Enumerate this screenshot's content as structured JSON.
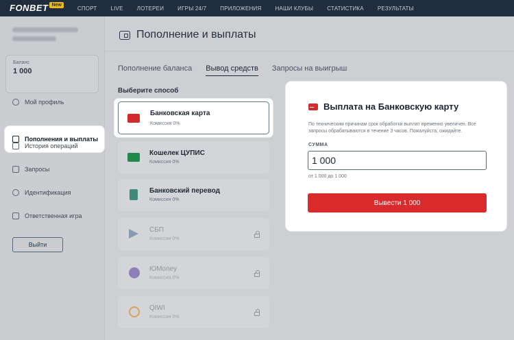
{
  "topbar": {
    "logo": "FONBET",
    "badge": "New",
    "nav": [
      "СПОРТ",
      "LIVE",
      "ЛОТЕРЕИ",
      "ИГРЫ 24/7",
      "ПРИЛОЖЕНИЯ",
      "НАШИ КЛУБЫ",
      "СТАТИСТИКА",
      "РЕЗУЛЬТАТЫ"
    ]
  },
  "sidebar": {
    "balance_label": "Баланс",
    "balance_value": "1 000",
    "items": [
      {
        "label": "Мой профиль",
        "icon": "user-icon"
      },
      {
        "label": "Пополнения и выплаты",
        "icon": "wallet-icon"
      },
      {
        "label": "История операций",
        "icon": "history-icon"
      },
      {
        "label": "Запросы",
        "icon": "requests-icon"
      },
      {
        "label": "Идентификация",
        "icon": "info-icon"
      },
      {
        "label": "Ответственная игра",
        "icon": "lock-icon"
      }
    ],
    "logout": "Выйти"
  },
  "main": {
    "title": "Пополнение и выплаты",
    "tabs": [
      "Пополнение баланса",
      "Вывод средств",
      "Запросы на выигрыш"
    ],
    "active_tab": "Вывод средств",
    "section_label": "Выберите способ",
    "methods": [
      {
        "name": "Банковская карта",
        "fee": "Комиссия 0%",
        "color": "#d22b2b"
      },
      {
        "name": "Кошелек ЦУПИС",
        "fee": "Комиссия 0%",
        "color": "#1f8a4c"
      },
      {
        "name": "Банковский перевод",
        "fee": "Комиссия 0%",
        "color": "#3f8a7a"
      },
      {
        "name": "СБП",
        "fee": "Комиссия 0%",
        "color": "#8a9ab0"
      },
      {
        "name": "ЮMoney",
        "fee": "Комиссия 0%",
        "color": "#8f7fb8"
      },
      {
        "name": "QIWI",
        "fee": "Комиссия 0%",
        "color": "#d9a35a"
      }
    ]
  },
  "panel": {
    "title": "Выплата на Банковскую карту",
    "note": "По техническим причинам срок обработки выплат временно увеличен. Все запросы обрабатываются в течение 3 часов. Пожалуйста, ожидайте.",
    "sum_label": "СУММА",
    "sum_value": "1 000",
    "range": "от 1 000 до 1 000",
    "submit": "Вывести 1 000"
  }
}
